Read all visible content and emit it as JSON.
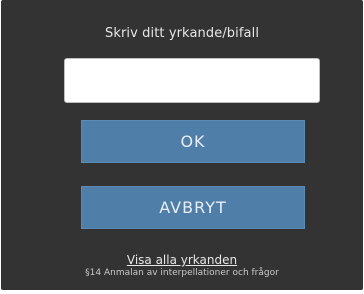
{
  "dialog": {
    "title": "Skriv ditt yrkande/bifall",
    "input": {
      "value": "",
      "placeholder": ""
    },
    "ok_label": "OK",
    "cancel_label": "AVBRYT",
    "show_all_link": "Visa alla yrkanden",
    "section_text": "§14 Anmalan av interpellationer och frågor"
  },
  "colors": {
    "panel_background": "#333333",
    "button_background": "#4f7fa8",
    "text_light": "#e6e6e6"
  }
}
